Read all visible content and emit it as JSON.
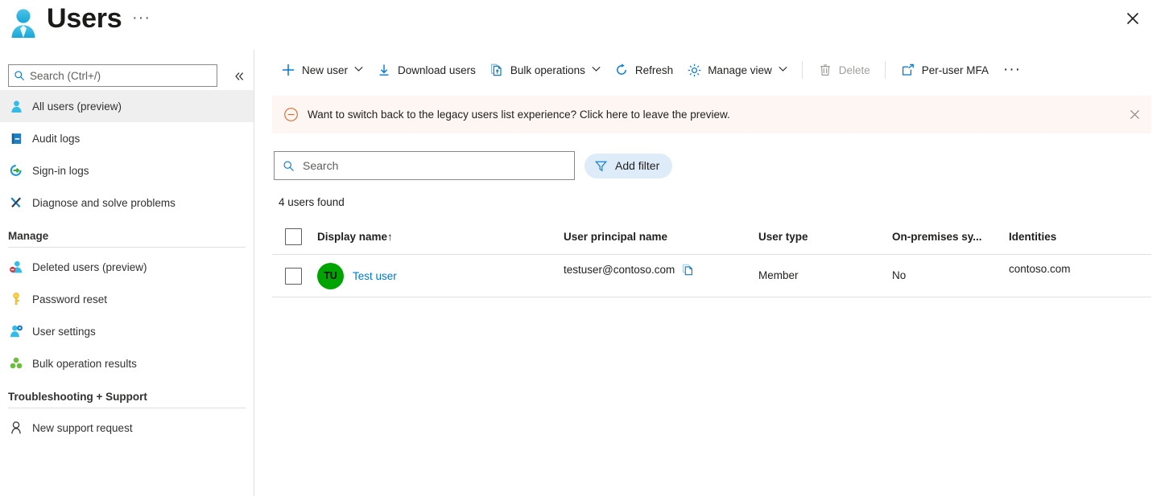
{
  "header": {
    "title": "Users",
    "overflow_label": "···",
    "icon": "user-icon",
    "close_icon": "close-icon"
  },
  "sidebar": {
    "search": {
      "placeholder": "Search (Ctrl+/)",
      "icon": "search-icon"
    },
    "collapse_icon": "double-chevron-left-icon",
    "items": [
      {
        "label": "All users (preview)",
        "icon": "user-icon",
        "selected": true
      },
      {
        "label": "Audit logs",
        "icon": "audit-log-icon",
        "selected": false
      },
      {
        "label": "Sign-in logs",
        "icon": "sign-in-icon",
        "selected": false
      },
      {
        "label": "Diagnose and solve problems",
        "icon": "wrench-screwdriver-icon",
        "selected": false
      }
    ],
    "groups": [
      {
        "title": "Manage",
        "items": [
          {
            "label": "Deleted users (preview)",
            "icon": "deleted-user-icon"
          },
          {
            "label": "Password reset",
            "icon": "key-icon"
          },
          {
            "label": "User settings",
            "icon": "user-settings-icon"
          },
          {
            "label": "Bulk operation results",
            "icon": "bulk-results-icon"
          }
        ]
      },
      {
        "title": "Troubleshooting + Support",
        "items": [
          {
            "label": "New support request",
            "icon": "support-person-icon"
          }
        ]
      }
    ]
  },
  "toolbar": {
    "new_user": {
      "label": "New user",
      "icon": "plus-icon",
      "has_chevron": true
    },
    "download_users": {
      "label": "Download users",
      "icon": "download-icon",
      "has_chevron": false
    },
    "bulk_operations": {
      "label": "Bulk operations",
      "icon": "bulk-upload-icon",
      "has_chevron": true
    },
    "refresh": {
      "label": "Refresh",
      "icon": "refresh-icon",
      "has_chevron": false
    },
    "manage_view": {
      "label": "Manage view",
      "icon": "gear-icon",
      "has_chevron": true
    },
    "delete": {
      "label": "Delete",
      "icon": "trash-icon",
      "disabled": true
    },
    "per_user_mfa": {
      "label": "Per-user MFA",
      "icon": "open-in-new-window-icon"
    },
    "overflow": "···"
  },
  "banner": {
    "icon": "circle-minus-icon",
    "text": "Want to switch back to the legacy users list experience? Click here to leave the preview.",
    "close_icon": "close-icon"
  },
  "filters": {
    "search": {
      "placeholder": "Search",
      "value": "",
      "icon": "search-icon"
    },
    "add_filter": {
      "label": "Add filter",
      "icon": "filter-icon"
    }
  },
  "results": {
    "count_text": "4 users found"
  },
  "table": {
    "select_all_checkbox": "unchecked",
    "columns": [
      {
        "key": "display_name",
        "label": "Display name",
        "sort": "↑"
      },
      {
        "key": "user_principal_name",
        "label": "User principal name",
        "sort": ""
      },
      {
        "key": "user_type",
        "label": "User type",
        "sort": ""
      },
      {
        "key": "on_premises_sync",
        "label": "On-premises sy...",
        "sort": ""
      },
      {
        "key": "identities",
        "label": "Identities",
        "sort": ""
      }
    ],
    "rows": [
      {
        "checkbox": "unchecked",
        "avatar_initials": "TU",
        "avatar_color": "#00a400",
        "display_name": "Test user",
        "user_principal_name": "testuser@contoso.com",
        "copy_icon": "copy-icon",
        "user_type": "Member",
        "on_premises_sync": "No",
        "identities": "contoso.com"
      }
    ]
  },
  "colors": {
    "accent": "#0078d4",
    "banner_bg": "#fdf6f3",
    "banner_icon": "#d83b01",
    "selected_nav": "#efefef",
    "filter_pill": "#deecf9"
  }
}
